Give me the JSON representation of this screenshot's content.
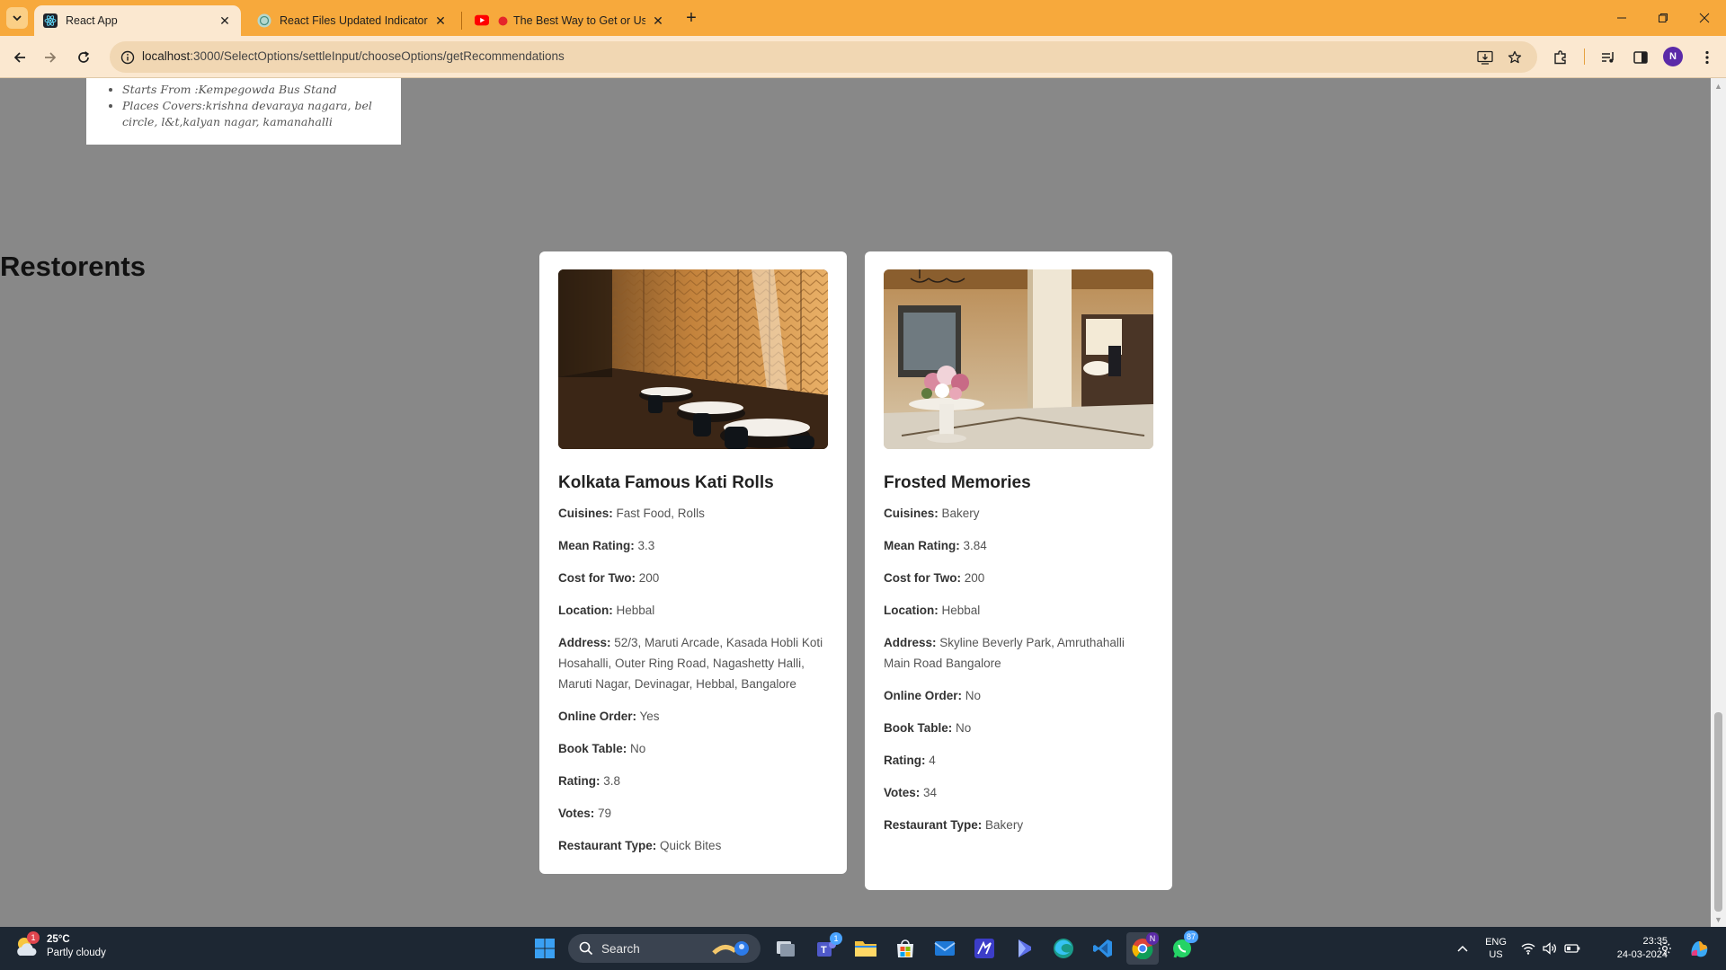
{
  "browser": {
    "tabs": [
      {
        "title": "React App",
        "active": true,
        "favicon": "react-icon"
      },
      {
        "title": "React Files Updated Indicator",
        "active": false,
        "favicon": "chatgpt-icon"
      },
      {
        "title": "The Best Way to Get or Use",
        "active": false,
        "favicon": "youtube-icon"
      }
    ],
    "url_host": "localhost",
    "url_path": ":3000/SelectOptions/settleInput/chooseOptions/getRecommendations",
    "profile_initial": "N"
  },
  "bus_info": {
    "items": [
      "Starts From :Kempegowda Bus Stand",
      "Places Covers:krishna devaraya nagara, bel circle, l&t,kalyan nagar, kamanahalli"
    ]
  },
  "section_title": "Restorents",
  "restaurants": [
    {
      "name": "Kolkata Famous Kati Rolls",
      "cuisines_label": "Cuisines:",
      "cuisines": "Fast Food, Rolls",
      "mean_rating_label": "Mean Rating:",
      "mean_rating": "3.3",
      "cost_label": "Cost for Two:",
      "cost": "200",
      "location_label": "Location:",
      "location": "Hebbal",
      "address_label": "Address:",
      "address": "52/3, Maruti Arcade, Kasada Hobli Koti Hosahalli, Outer Ring Road, Nagashetty Halli, Maruti Nagar, Devinagar, Hebbal, Bangalore",
      "online_label": "Online Order:",
      "online": "Yes",
      "book_label": "Book Table:",
      "book": "No",
      "rating_label": "Rating:",
      "rating": "3.8",
      "votes_label": "Votes:",
      "votes": "79",
      "type_label": "Restaurant Type:",
      "type": "Quick Bites"
    },
    {
      "name": "Frosted Memories",
      "cuisines_label": "Cuisines:",
      "cuisines": "Bakery",
      "mean_rating_label": "Mean Rating:",
      "mean_rating": "3.84",
      "cost_label": "Cost for Two:",
      "cost": "200",
      "location_label": "Location:",
      "location": "Hebbal",
      "address_label": "Address:",
      "address": "Skyline Beverly Park, Amruthahalli Main Road Bangalore",
      "online_label": "Online Order:",
      "online": "No",
      "book_label": "Book Table:",
      "book": "No",
      "rating_label": "Rating:",
      "rating": "4",
      "votes_label": "Votes:",
      "votes": "34",
      "type_label": "Restaurant Type:",
      "type": "Bakery"
    }
  ],
  "taskbar": {
    "weather_temp": "25°C",
    "weather_desc": "Partly cloudy",
    "weather_badge": "1",
    "search_placeholder": "Search",
    "teams_badge": "1",
    "whatsapp_badge": "87",
    "lang_line1": "ENG",
    "lang_line2": "US",
    "time": "23:35",
    "date": "24-03-2024"
  },
  "colors": {
    "tabbar": "#f7a93c",
    "toolbar": "#fbe8d0",
    "page_bg": "#888888",
    "taskbar": "#1d2733"
  }
}
